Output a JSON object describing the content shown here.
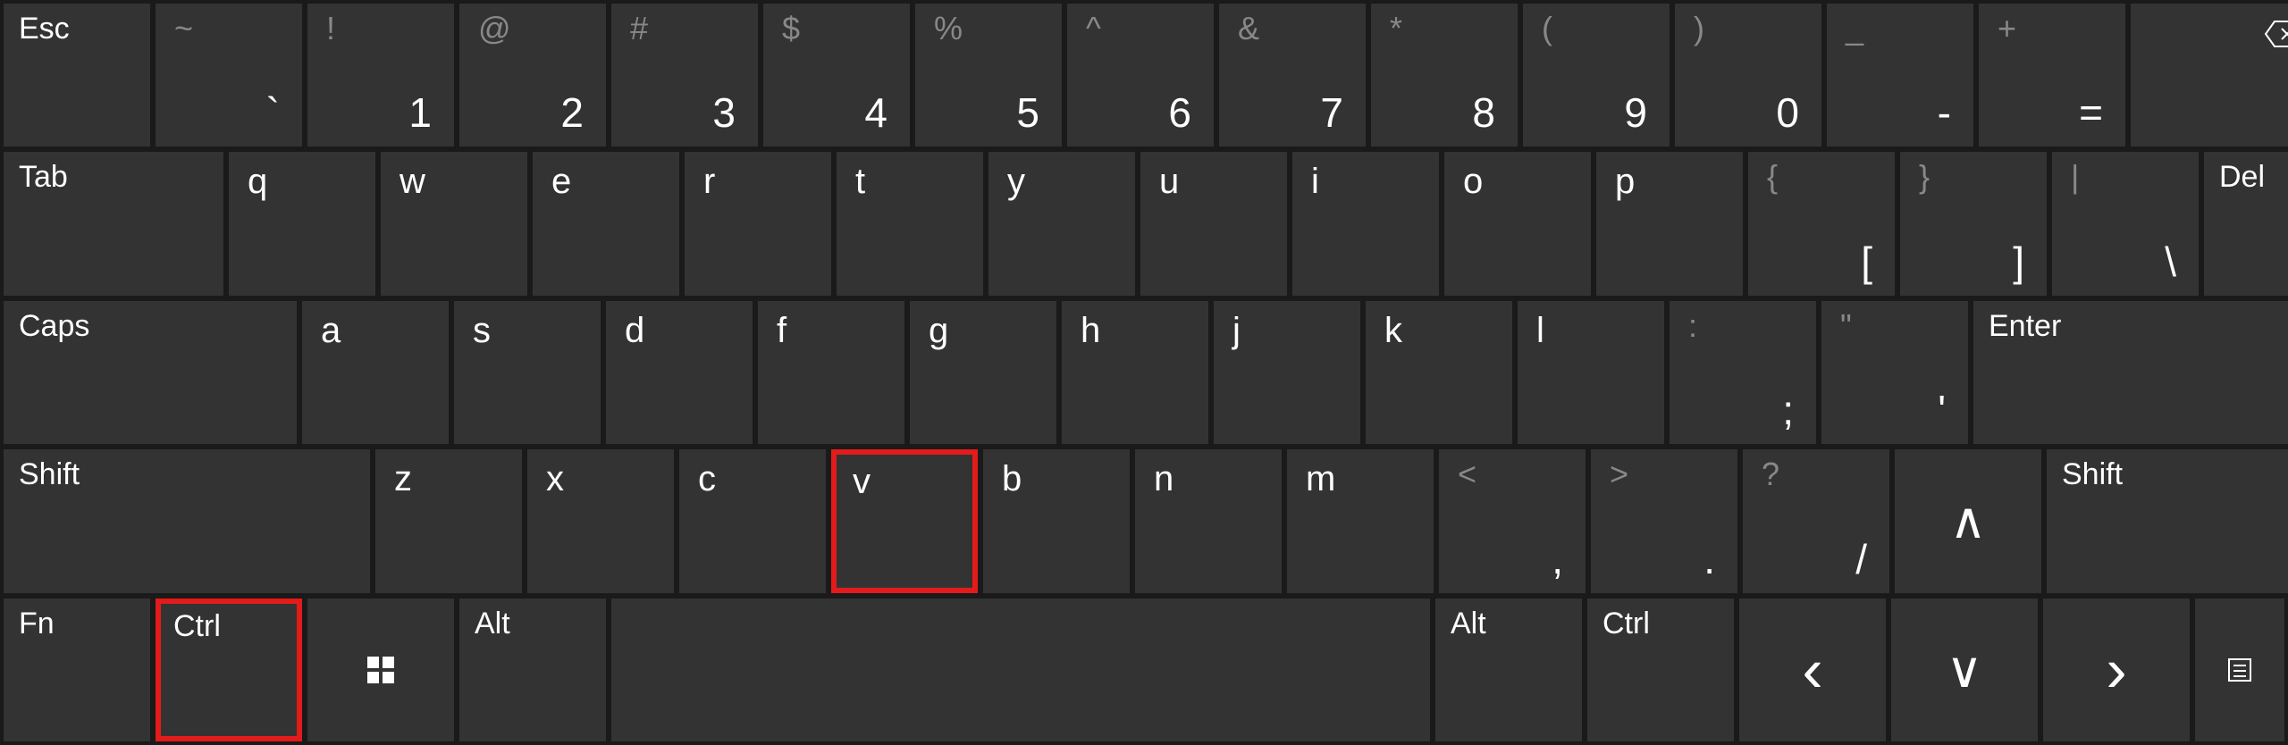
{
  "highlight": {
    "ctrl_left": true,
    "v": true
  },
  "row1": {
    "esc": "Esc",
    "keys": [
      {
        "upper": "~",
        "lower": "`"
      },
      {
        "upper": "!",
        "lower": "1"
      },
      {
        "upper": "@",
        "lower": "2"
      },
      {
        "upper": "#",
        "lower": "3"
      },
      {
        "upper": "$",
        "lower": "4"
      },
      {
        "upper": "%",
        "lower": "5"
      },
      {
        "upper": "^",
        "lower": "6"
      },
      {
        "upper": "&",
        "lower": "7"
      },
      {
        "upper": "*",
        "lower": "8"
      },
      {
        "upper": "(",
        "lower": "9"
      },
      {
        "upper": ")",
        "lower": "0"
      },
      {
        "upper": "_",
        "lower": "-"
      },
      {
        "upper": "+",
        "lower": "="
      }
    ],
    "backspace_icon": "backspace-icon"
  },
  "row2": {
    "tab": "Tab",
    "letters": [
      "q",
      "w",
      "e",
      "r",
      "t",
      "y",
      "u",
      "i",
      "o",
      "p"
    ],
    "brackets": [
      {
        "upper": "{",
        "lower": "["
      },
      {
        "upper": "}",
        "lower": "]"
      },
      {
        "upper": "|",
        "lower": "\\"
      }
    ],
    "del": "Del"
  },
  "row3": {
    "caps": "Caps",
    "letters": [
      "a",
      "s",
      "d",
      "f",
      "g",
      "h",
      "j",
      "k",
      "l"
    ],
    "punct": [
      {
        "upper": ":",
        "lower": ";"
      },
      {
        "upper": "\"",
        "lower": "'"
      }
    ],
    "enter": "Enter"
  },
  "row4": {
    "lshift": "Shift",
    "letters": [
      "z",
      "x",
      "c",
      "v",
      "b",
      "n",
      "m"
    ],
    "punct": [
      {
        "upper": "<",
        "lower": ","
      },
      {
        "upper": ">",
        "lower": "."
      },
      {
        "upper": "?",
        "lower": "/"
      }
    ],
    "up_icon": "chevron-up-icon",
    "rshift": "Shift"
  },
  "row5": {
    "fn": "Fn",
    "ctrl_l": "Ctrl",
    "win_icon": "windows-icon",
    "alt_l": "Alt",
    "space": "",
    "alt_r": "Alt",
    "ctrl_r": "Ctrl",
    "left_icon": "chevron-left-icon",
    "down_icon": "chevron-down-icon",
    "right_icon": "chevron-right-icon",
    "menu_icon": "menu-icon"
  }
}
